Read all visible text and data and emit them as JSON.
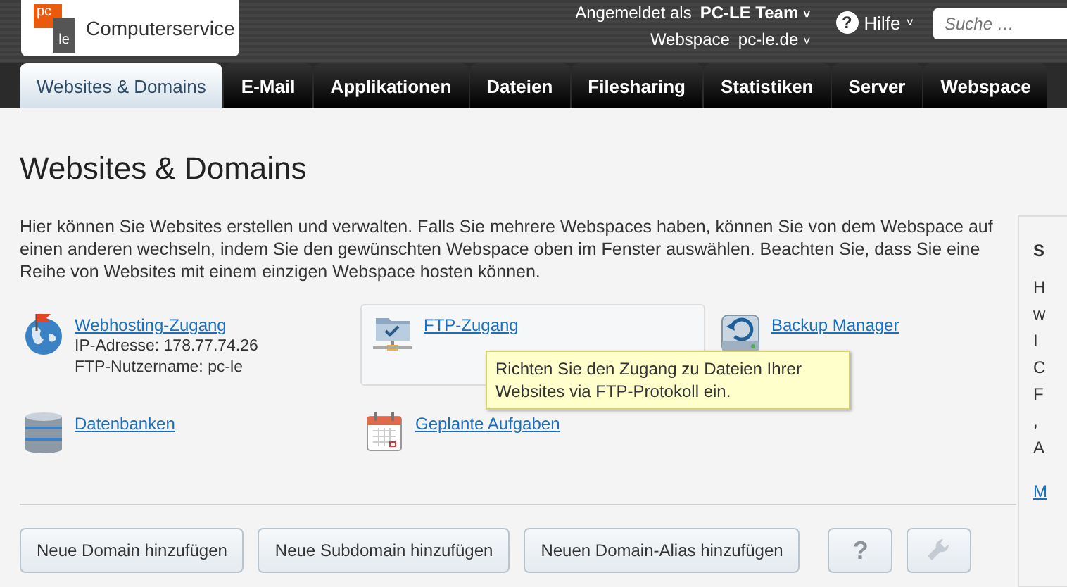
{
  "header": {
    "logo_text": [
      "pc",
      "le"
    ],
    "brand": "Computerservice",
    "login_label": "Angemeldet als",
    "login_user": "PC-LE Team",
    "webspace_label": "Webspace",
    "webspace_value": "pc-le.de",
    "help": "Hilfe",
    "help_glyph": "?",
    "caret": "˅",
    "search": {
      "placeholder": "Suche …"
    }
  },
  "tabs": [
    {
      "label": "Websites & Domains",
      "selected": true
    },
    {
      "label": "E-Mail",
      "selected": false
    },
    {
      "label": "Applikationen",
      "selected": false
    },
    {
      "label": "Dateien",
      "selected": false
    },
    {
      "label": "Filesharing",
      "selected": false
    },
    {
      "label": "Statistiken",
      "selected": false
    },
    {
      "label": "Server",
      "selected": false
    },
    {
      "label": "Webspace",
      "selected": false
    }
  ],
  "page": {
    "title": "Websites & Domains",
    "intro": "Hier können Sie Websites erstellen und verwalten. Falls Sie mehrere Webspaces haben, können Sie von dem Webspace auf einen anderen wechseln, indem Sie den gewünschten Webspace oben im Fenster auswählen. Beachten Sie, dass Sie eine Reihe von Websites mit einem einzigen Webspace hosten können."
  },
  "tools": [
    {
      "kind": "globe",
      "label": "Webhosting-Zugang",
      "details": [
        "IP-Adresse: 178.77.74.26",
        "FTP-Nutzername: pc-le"
      ],
      "highlighted": false
    },
    {
      "kind": "ftp",
      "label": "FTP-Zugang",
      "highlighted": true,
      "tooltip": "Richten Sie den Zugang zu Dateien Ihrer Websites via FTP-Protokoll ein."
    },
    {
      "kind": "backup",
      "label": "Backup Manager",
      "highlighted": false
    },
    {
      "kind": "database",
      "label": "Datenbanken",
      "highlighted": false
    },
    {
      "kind": "calendar",
      "label": "Geplante Aufgaben",
      "highlighted": false
    }
  ],
  "buttons": [
    {
      "kind": "text",
      "label": "Neue Domain hinzufügen"
    },
    {
      "kind": "text",
      "label": "Neue Subdomain hinzufügen"
    },
    {
      "kind": "text",
      "label": "Neuen Domain-Alias hinzufügen"
    },
    {
      "kind": "help",
      "label": "?"
    },
    {
      "kind": "settings"
    }
  ],
  "side_panel": {
    "title": "S",
    "lines": [
      "H",
      "w",
      "I",
      "C",
      "F",
      ",",
      "A"
    ],
    "link": "M"
  }
}
